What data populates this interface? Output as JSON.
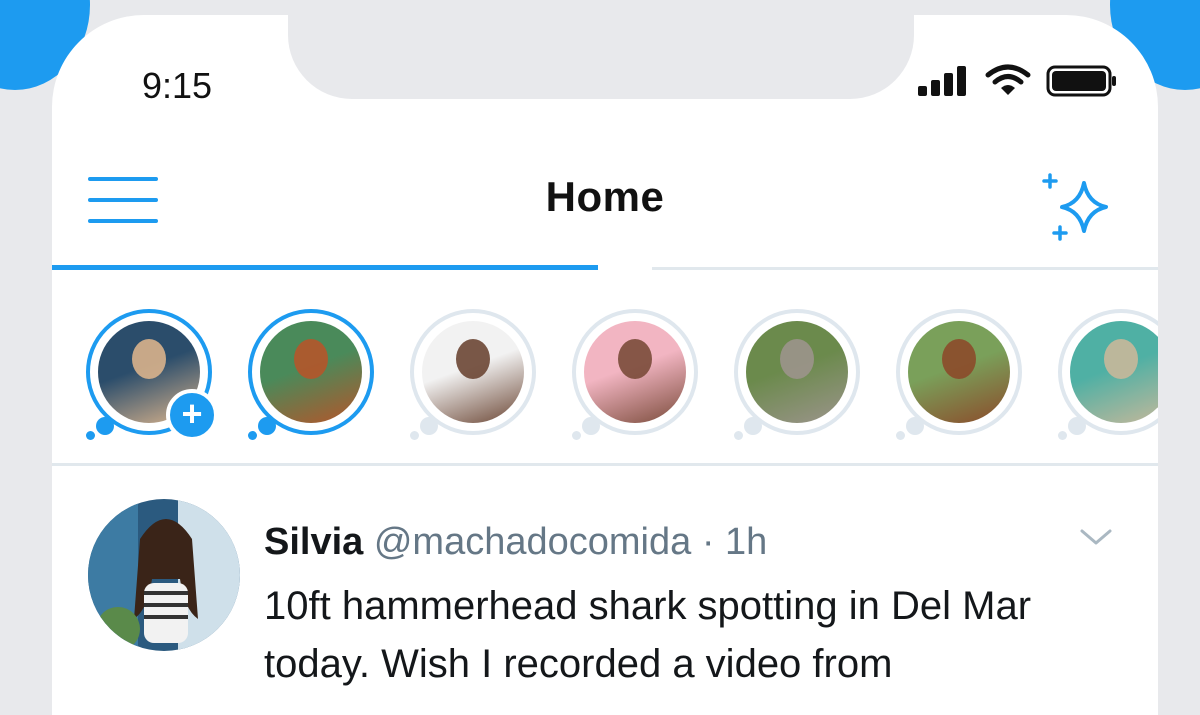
{
  "status_bar": {
    "time": "9:15"
  },
  "header": {
    "title": "Home"
  },
  "tabs": [
    {
      "state": "active"
    },
    {
      "state": "inactive"
    }
  ],
  "fleets": [
    {
      "name": "your-fleet",
      "active": true,
      "has_add": true,
      "add_glyph": "+",
      "colors": [
        "#2b4d6b",
        "#d9b38c"
      ]
    },
    {
      "name": "fleet-man-hat",
      "active": true,
      "has_add": false,
      "colors": [
        "#4a8a5a",
        "#b5552a"
      ]
    },
    {
      "name": "fleet-woman-bangs",
      "active": false,
      "has_add": false,
      "colors": [
        "#f2f2f2",
        "#6b4634"
      ]
    },
    {
      "name": "fleet-woman-pink",
      "active": false,
      "has_add": false,
      "colors": [
        "#f2b5c2",
        "#7a4b3a"
      ]
    },
    {
      "name": "fleet-dog",
      "active": false,
      "has_add": false,
      "colors": [
        "#6b8a4c",
        "#9c948c"
      ]
    },
    {
      "name": "fleet-woman-smile",
      "active": false,
      "has_add": false,
      "colors": [
        "#7aa05a",
        "#8c4a2a"
      ]
    },
    {
      "name": "fleet-pool-dog",
      "active": false,
      "has_add": false,
      "colors": [
        "#4fb0a4",
        "#c8b89a"
      ]
    }
  ],
  "tweet": {
    "name": "Silvia",
    "handle": "@machadocomida",
    "separator": "·",
    "time": "1h",
    "text": "10ft hammerhead shark spotting in Del Mar today. Wish I recorded a video from"
  },
  "colors": {
    "accent": "#1d9bf0",
    "divider": "#e1e8ed",
    "text": "#14171a",
    "muted": "#657786"
  }
}
